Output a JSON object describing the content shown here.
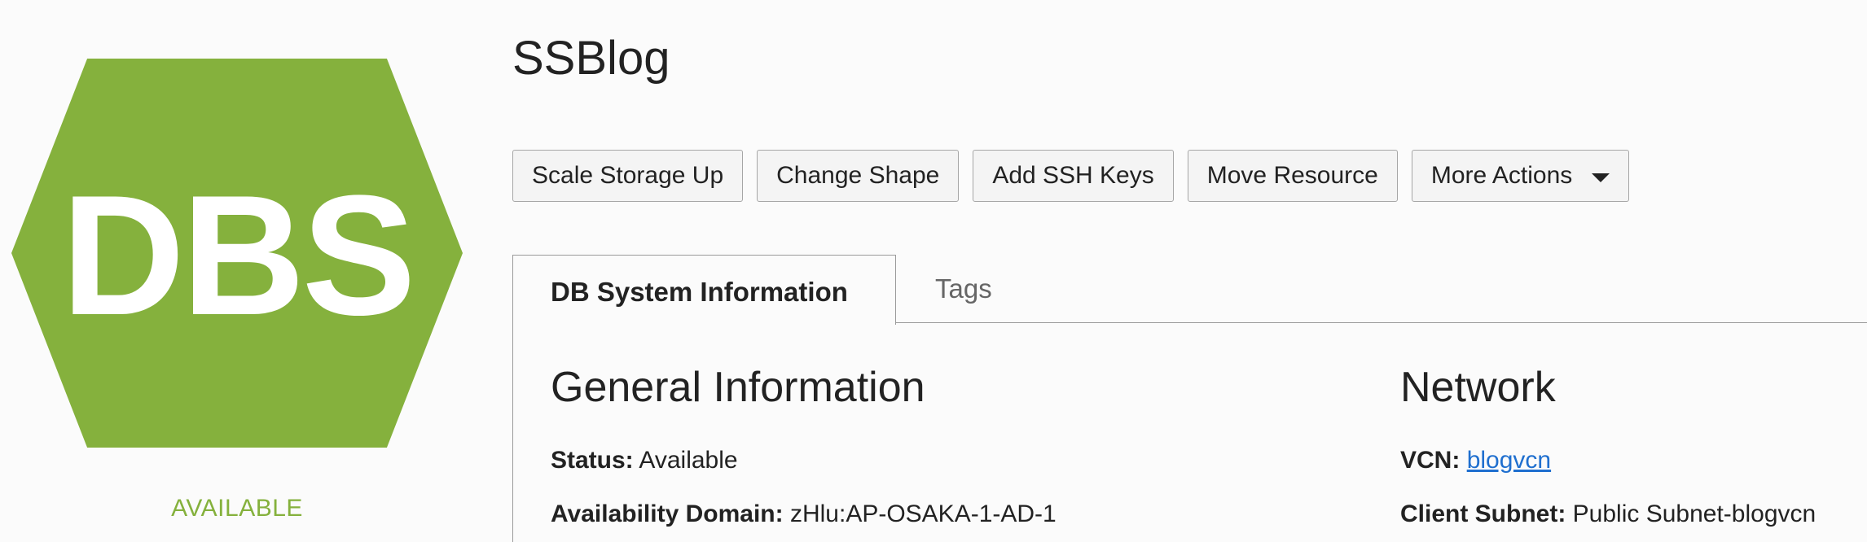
{
  "badge": {
    "icon_label": "DBS",
    "status": "AVAILABLE",
    "color": "#85b13d"
  },
  "title": "SSBlog",
  "actions": {
    "scale_storage": "Scale Storage Up",
    "change_shape": "Change Shape",
    "add_ssh_keys": "Add SSH Keys",
    "move_resource": "Move Resource",
    "more_actions": "More Actions"
  },
  "tabs": {
    "db_system_info": "DB System Information",
    "tags": "Tags"
  },
  "general": {
    "heading": "General Information",
    "status_key": "Status:",
    "status_value": "Available",
    "ad_key": "Availability Domain:",
    "ad_value": "zHlu:AP-OSAKA-1-AD-1"
  },
  "network": {
    "heading": "Network",
    "vcn_key": "VCN:",
    "vcn_value": "blogvcn",
    "subnet_key": "Client Subnet:",
    "subnet_value": "Public Subnet-blogvcn"
  },
  "colors": {
    "accent": "#85b13d",
    "link": "#1f6fcf"
  }
}
